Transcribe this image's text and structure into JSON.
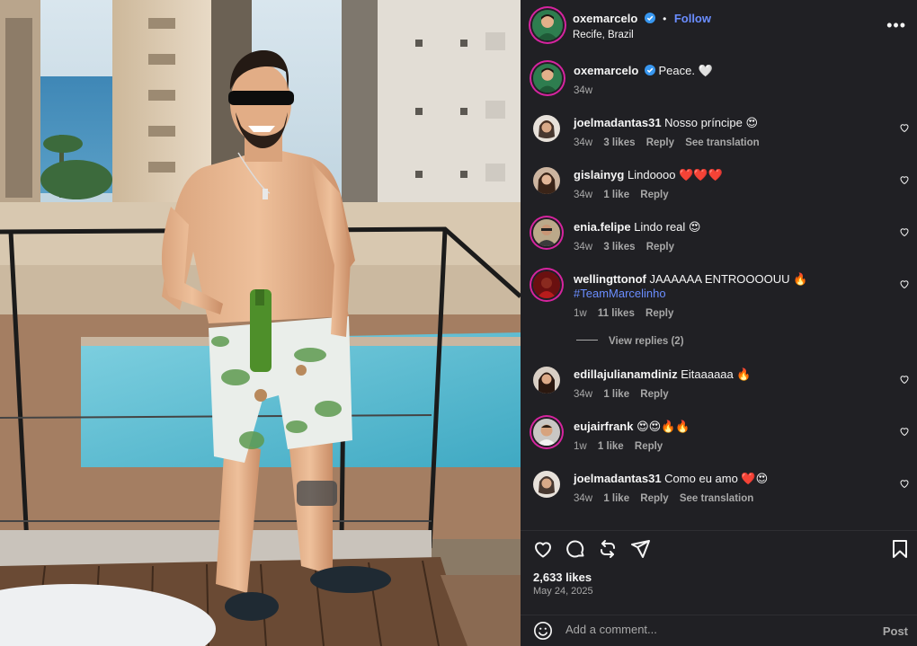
{
  "post": {
    "author": "oxemarcelo",
    "follow_label": "Follow",
    "location": "Recife, Brazil",
    "more_label": "•••",
    "caption": "Peace. 🤍",
    "caption_time": "34w"
  },
  "comments": [
    {
      "user": "joelmadantas31",
      "text": "Nosso príncipe 😍",
      "time": "34w",
      "likes": "3 likes",
      "reply": "Reply",
      "translate": "See translation"
    },
    {
      "user": "gislainyg",
      "text": "Lindoooo ❤️❤️❤️",
      "time": "34w",
      "likes": "1 like",
      "reply": "Reply"
    },
    {
      "user": "enia.felipe",
      "text": "Lindo real 😍",
      "time": "34w",
      "likes": "3 likes",
      "reply": "Reply"
    },
    {
      "user": "wellingttonof",
      "text": "JAAAAAA ENTROOOOUU 🔥",
      "hashtag": "#TeamMarcelinho",
      "time": "1w",
      "likes": "11 likes",
      "reply": "Reply",
      "view_replies": "View replies (2)"
    },
    {
      "user": "edillajulianamdiniz",
      "text": "Eitaaaaaa 🔥",
      "time": "34w",
      "likes": "1 like",
      "reply": "Reply"
    },
    {
      "user": "eujairfrank",
      "text": "😍😍🔥🔥",
      "time": "1w",
      "likes": "1 like",
      "reply": "Reply"
    },
    {
      "user": "joelmadantas31",
      "text": "Como eu amo ❤️😍",
      "time": "34w",
      "likes": "1 like",
      "reply": "Reply",
      "translate": "See translation"
    }
  ],
  "footer": {
    "likes": "2,633 likes",
    "date": "May 24, 2025",
    "comment_placeholder": "Add a comment...",
    "post_label": "Post"
  },
  "icons": [
    "verified-icon",
    "more-icon",
    "heart-icon",
    "comment-icon",
    "repost-icon",
    "share-icon",
    "bookmark-icon",
    "emoji-icon"
  ],
  "colors": {
    "accent": "#6a8dff",
    "panel": "#202024",
    "verified": "#3897f0"
  }
}
